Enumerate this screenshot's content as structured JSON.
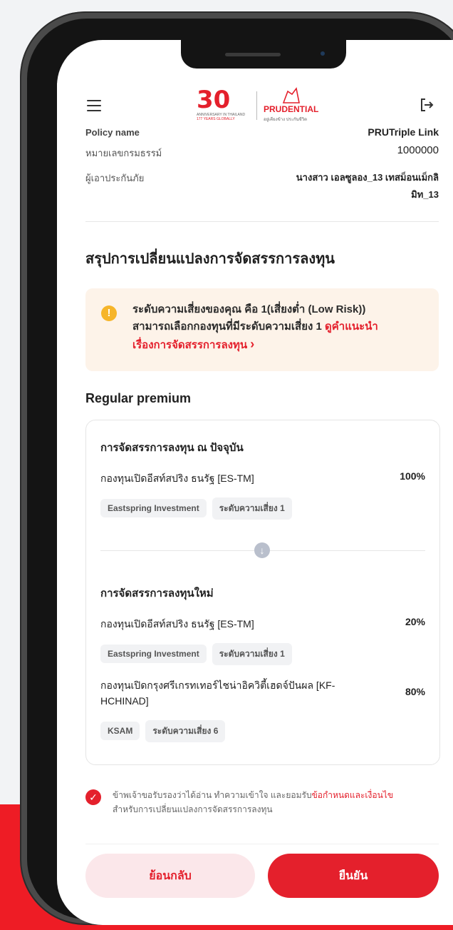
{
  "header": {
    "menu_icon": "menu-icon",
    "logo_30_text": "30",
    "logo_30_sub1": "ANNIVERSARY IN THAILAND",
    "logo_30_sub2": "177 YEARS GLOBALLY",
    "brand_name": "PRUDENTIAL",
    "brand_tagline": "อยู่เคียงข้าง ประกันชีวิต",
    "logout_icon": "logout-icon"
  },
  "policy": {
    "name_label": "Policy name",
    "name_value": "PRUTriple Link",
    "number_label": "หมายเลขกรมธรรม์",
    "number_value": "1000000",
    "insured_label": "ผู้เอาประกันภัย",
    "insured_value_line1": "นางสาว เอลซูลอง_13 เทสม็อนเม็กลิ",
    "insured_value_line2": "มิท_13"
  },
  "summary": {
    "title": "สรุปการเปลี่ยนแปลงการจัดสรรการลงทุน",
    "risk_text_1": "ระดับความเสี่ยงของคุณ คือ 1(เสี่ยงต่ำ (Low Risk))",
    "risk_text_2": "สามารถเลือกกองทุนที่มีระดับความเสี่ยง 1",
    "risk_link_1": "ดูคำแนะนำ",
    "risk_link_2": "เรื่องการจัดสรรการลงทุน",
    "risk_link_arrow": "›"
  },
  "regular_premium": {
    "title": "Regular premium",
    "current": {
      "title": "การจัดสรรการลงทุน ณ ปัจจุบัน",
      "funds": [
        {
          "name": "กองทุนเปิดอีสท์สปริง ธนรัฐ [ES-TM]",
          "percent": "100%",
          "tags": [
            "Eastspring Investment",
            "ระดับความเสี่ยง 1"
          ]
        }
      ]
    },
    "new": {
      "title": "การจัดสรรการลงทุนใหม่",
      "funds": [
        {
          "name": "กองทุนเปิดอีสท์สปริง ธนรัฐ [ES-TM]",
          "percent": "20%",
          "tags": [
            "Eastspring Investment",
            "ระดับความเสี่ยง 1"
          ]
        },
        {
          "name_line1": "กองทุนเปิดกรุงศรีเกรทเทอร์ไชน่าอิควิตี้เฮดจ์ปันผล [KF-",
          "name_line2": "HCHINAD]",
          "percent": "80%",
          "tags": [
            "KSAM",
            "ระดับความเสี่ยง 6"
          ]
        }
      ]
    }
  },
  "consent": {
    "text_1": "ข้าพเจ้าขอรับรองว่าได้อ่าน ทำความเข้าใจ และยอมรับ",
    "link": "ข้อกำหนดและเงื่อนไข",
    "text_2": "สำหรับการเปลี่ยนแปลงการจัดสรรการลงทุน",
    "checked": true
  },
  "buttons": {
    "back": "ย้อนกลับ",
    "confirm": "ยืนยัน"
  },
  "colors": {
    "accent": "#e4202c",
    "risk_bg": "#fdf3e9",
    "warning": "#f6b52a",
    "frame": "#4a4a4a"
  }
}
